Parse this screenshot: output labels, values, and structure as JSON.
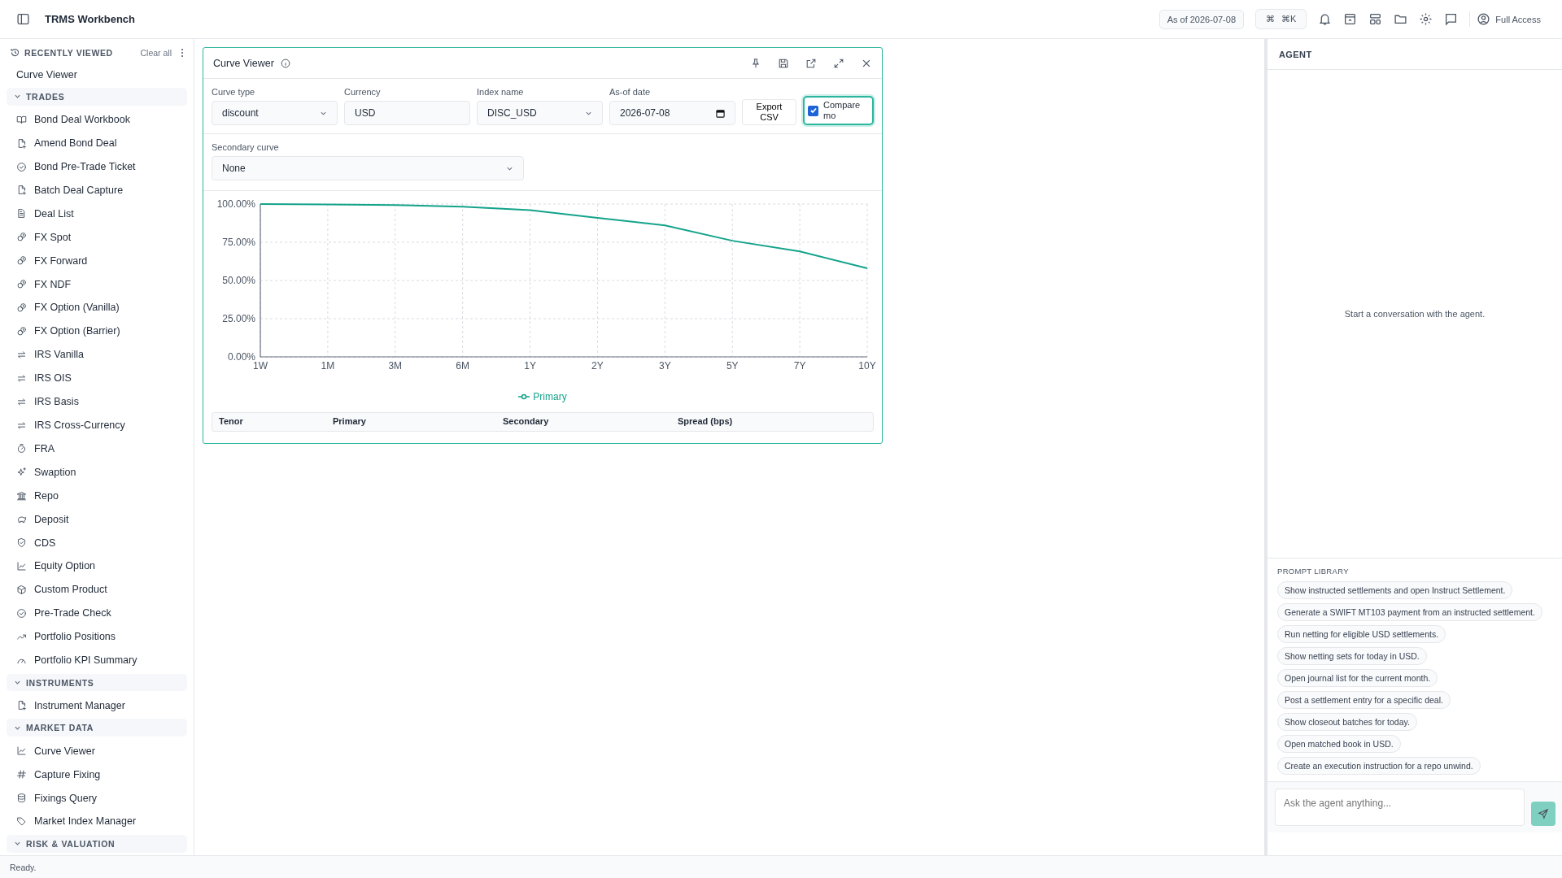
{
  "app": {
    "title": "TRMS Workbench"
  },
  "toolbar": {
    "as_of": "As of 2026-07-08",
    "command_symbol": "⌘",
    "command_key": "⌘K",
    "account": "Full Access"
  },
  "sidebar": {
    "recent_title": "RECENTLY VIEWED",
    "clear_all": "Clear all",
    "recent": [
      "Curve Viewer"
    ],
    "sections": [
      {
        "title": "TRADES",
        "expanded": true,
        "items": [
          "Bond Deal Workbook",
          "Amend Bond Deal",
          "Bond Pre-Trade Ticket",
          "Batch Deal Capture",
          "Deal List",
          "FX Spot",
          "FX Forward",
          "FX NDF",
          "FX Option (Vanilla)",
          "FX Option (Barrier)",
          "IRS Vanilla",
          "IRS OIS",
          "IRS Basis",
          "IRS Cross-Currency",
          "FRA",
          "Swaption",
          "Repo",
          "Deposit",
          "CDS",
          "Equity Option",
          "Custom Product",
          "Pre-Trade Check",
          "Portfolio Positions",
          "Portfolio KPI Summary"
        ]
      },
      {
        "title": "INSTRUMENTS",
        "expanded": true,
        "items": [
          "Instrument Manager"
        ]
      },
      {
        "title": "MARKET DATA",
        "expanded": true,
        "items": [
          "Curve Viewer",
          "Capture Fixing",
          "Fixings Query",
          "Market Index Manager"
        ]
      },
      {
        "title": "RISK & VALUATION",
        "expanded": true
      }
    ]
  },
  "panel": {
    "title": "Curve Viewer",
    "filters": [
      {
        "label": "Curve type",
        "kind": "select",
        "value": "discount"
      },
      {
        "label": "Currency",
        "kind": "text",
        "value": "USD"
      },
      {
        "label": "Index name",
        "kind": "select",
        "value": "DISC_USD"
      },
      {
        "label": "As-of date",
        "kind": "date",
        "value": "2026-07-08"
      }
    ],
    "export_button": "Export CSV",
    "compare": {
      "label": "Compare mo",
      "checked": true
    },
    "secondary": {
      "label": "Secondary curve",
      "value": "None"
    },
    "chart_data": {
      "type": "line",
      "categories": [
        "1W",
        "1M",
        "3M",
        "6M",
        "1Y",
        "2Y",
        "3Y",
        "5Y",
        "7Y",
        "10Y"
      ],
      "series": [
        {
          "name": "Primary",
          "color": "#14a38b",
          "values": [
            100,
            99.8,
            99.3,
            98.3,
            96,
            91,
            86,
            76,
            69,
            58
          ]
        }
      ],
      "grid": true,
      "ylim": [
        0,
        100
      ],
      "yticks": [
        {
          "value": 0,
          "label": "0.00%"
        },
        {
          "value": 25,
          "label": "25.00%"
        },
        {
          "value": 50,
          "label": "50.00%"
        },
        {
          "value": 75,
          "label": "75.00%"
        },
        {
          "value": 100,
          "label": "100.00%"
        }
      ]
    },
    "table": {
      "columns": [
        "Tenor",
        "Primary",
        "Secondary",
        "Spread (bps)"
      ]
    }
  },
  "agent": {
    "title": "AGENT",
    "empty_message": "Start a conversation with the agent.",
    "library_title": "PROMPT LIBRARY",
    "prompts": [
      "Show instructed settlements and open Instruct Settlement.",
      "Generate a SWIFT MT103 payment from an instructed settlement.",
      "Run netting for eligible USD settlements.",
      "Show netting sets for today in USD.",
      "Open journal list for the current month.",
      "Post a settlement entry for a specific deal.",
      "Show closeout batches for today.",
      "Open matched book in USD.",
      "Create an execution instruction for a repo unwind."
    ],
    "input": {
      "placeholder": "Ask the agent anything..."
    }
  },
  "status_bar": {
    "text": "Ready."
  }
}
